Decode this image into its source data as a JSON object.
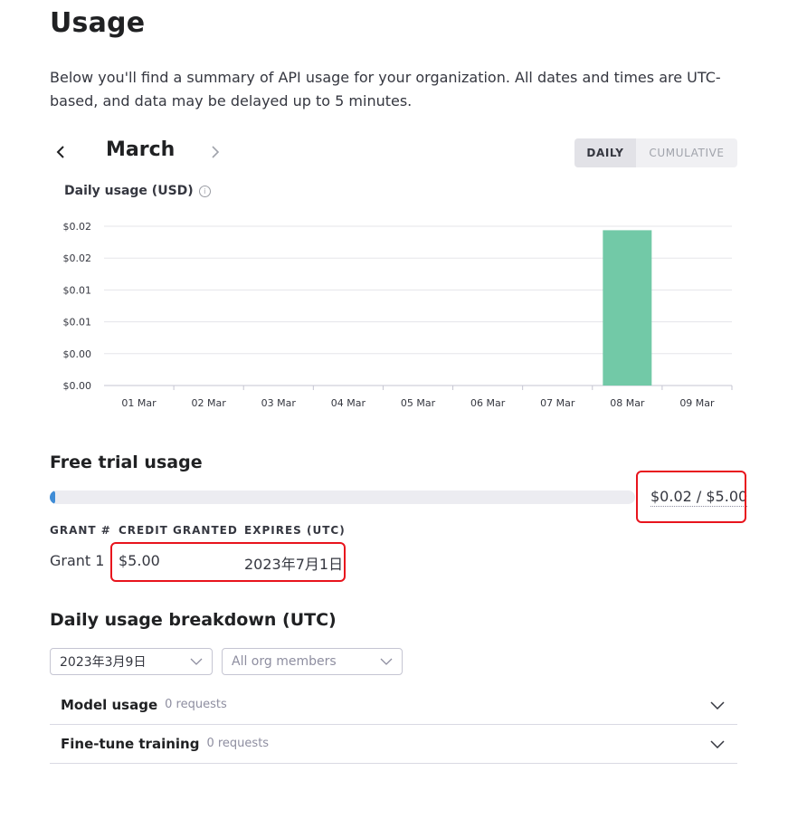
{
  "page": {
    "title": "Usage",
    "description": "Below you'll find a summary of API usage for your organization. All dates and times are UTC-based, and data may be delayed up to 5 minutes."
  },
  "month_nav": {
    "month": "March"
  },
  "view_toggle": {
    "daily": "DAILY",
    "cumulative": "CUMULATIVE",
    "selected": "DAILY"
  },
  "chart_data": {
    "type": "bar",
    "title": "Daily usage (USD)",
    "categories": [
      "01 Mar",
      "02 Mar",
      "03 Mar",
      "04 Mar",
      "05 Mar",
      "06 Mar",
      "07 Mar",
      "08 Mar",
      "09 Mar"
    ],
    "values": [
      0,
      0,
      0,
      0,
      0,
      0,
      0,
      0.0195,
      0
    ],
    "ytick_labels": [
      "$0.00",
      "$0.00",
      "$0.01",
      "$0.01",
      "$0.02",
      "$0.02"
    ],
    "ylim": [
      0,
      0.02
    ],
    "grid": true,
    "bar_color": "#72c9a7"
  },
  "free_trial": {
    "title": "Free trial usage",
    "amount_text": "$0.02 / $5.00",
    "progress_fraction": 0.004,
    "progress_color": "#3f8cd6",
    "table": {
      "headers": [
        "GRANT #",
        "CREDIT GRANTED",
        "EXPIRES (UTC)"
      ],
      "rows": [
        [
          "Grant 1",
          "$5.00",
          "2023年7月1日"
        ]
      ]
    }
  },
  "breakdown": {
    "title": "Daily usage breakdown (UTC)",
    "date_select": "2023年3月9日",
    "member_select_placeholder": "All org members",
    "rows": [
      {
        "label": "Model usage",
        "count": "0 requests"
      },
      {
        "label": "Fine-tune training",
        "count": "0 requests"
      }
    ]
  },
  "highlight_color": "#e8141d"
}
